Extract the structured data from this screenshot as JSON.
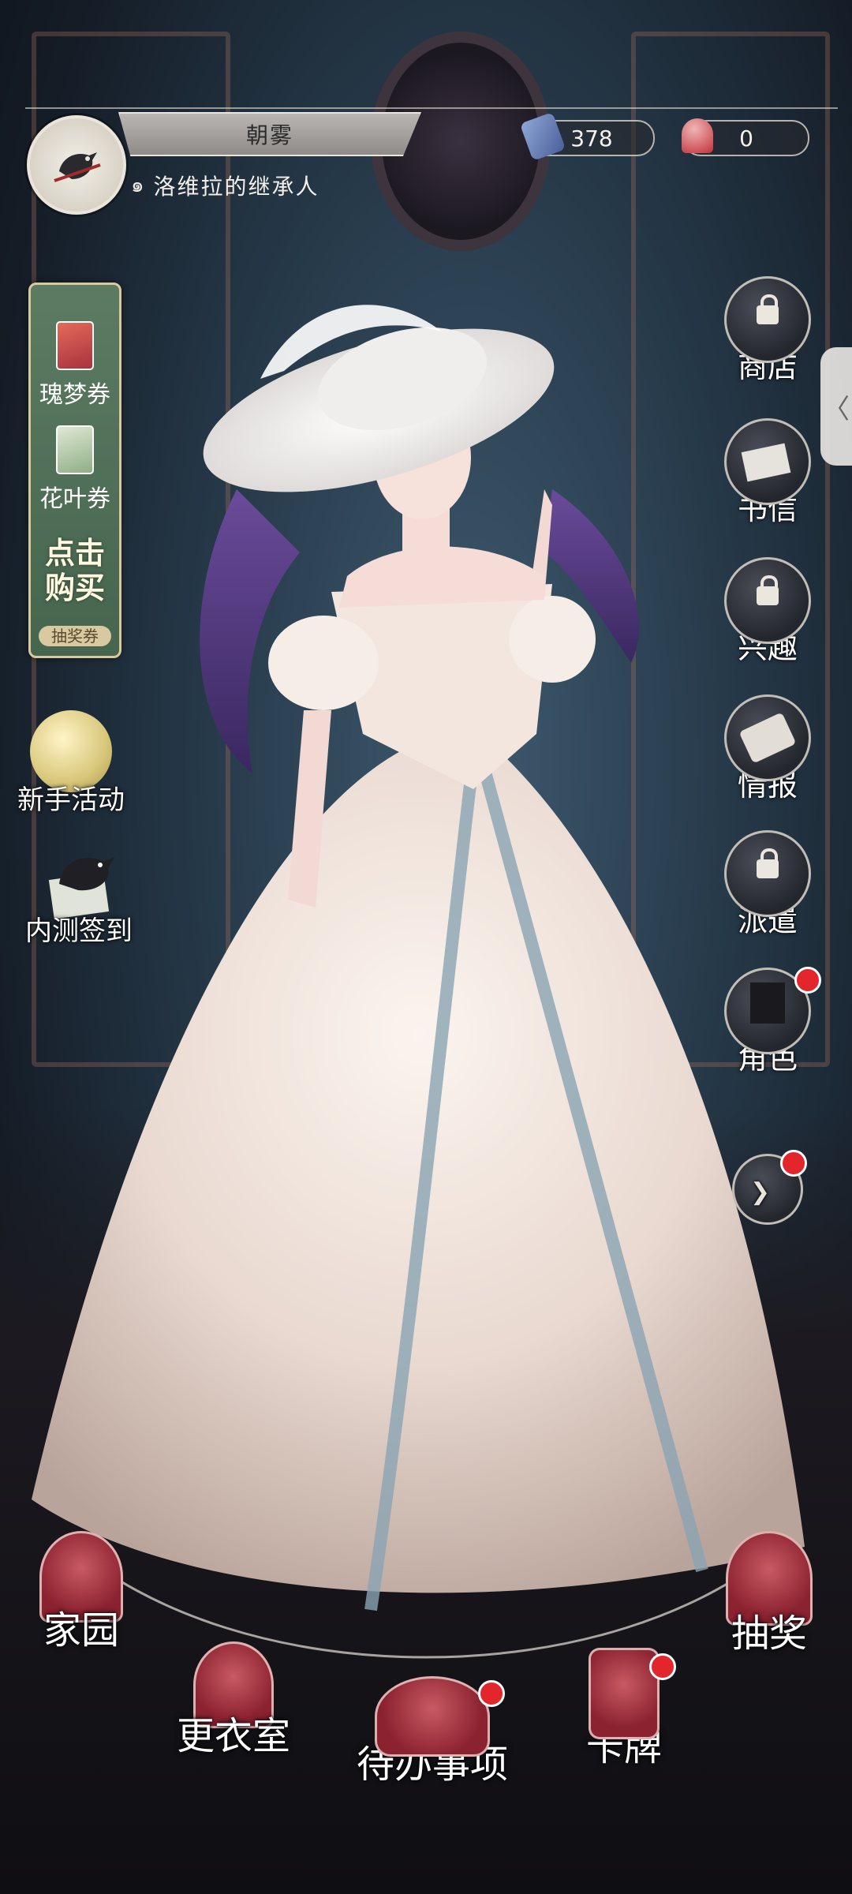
{
  "player": {
    "name": "朝雾",
    "title": "洛维拉的继承人"
  },
  "currencies": [
    {
      "icon": "quill-icon",
      "value": "378"
    },
    {
      "icon": "bell-icon",
      "value": "0"
    }
  ],
  "tickets": {
    "items": [
      {
        "label": "瑰梦券",
        "icon": "rose-card-icon"
      },
      {
        "label": "花叶券",
        "icon": "leaf-card-icon"
      }
    ],
    "buy_label_1": "点击",
    "buy_label_2": "购买",
    "buy_sub": "抽奖券"
  },
  "left_buttons": [
    {
      "label": "新手活动",
      "icon": "golden-orb-icon"
    },
    {
      "label": "内测签到",
      "icon": "crow-letter-icon"
    }
  ],
  "right_menu": [
    {
      "label": "商店",
      "locked": true
    },
    {
      "label": "书信",
      "locked": false
    },
    {
      "label": "兴趣",
      "locked": true
    },
    {
      "label": "情报",
      "locked": false
    },
    {
      "label": "派遣",
      "locked": true
    },
    {
      "label": "角色",
      "locked": false,
      "badge": true
    },
    {
      "label": "",
      "locked": false,
      "badge": true
    }
  ],
  "side_tab": "〈",
  "bottom_nav": [
    {
      "label": "家园",
      "icon": "arch-window-icon"
    },
    {
      "label": "更衣室",
      "icon": "dress-icon"
    },
    {
      "label": "待办事项",
      "icon": "hat-icon",
      "badge": true
    },
    {
      "label": "卡牌",
      "icon": "card-icon",
      "badge": true
    },
    {
      "label": "抽奖",
      "icon": "rose-icon"
    }
  ],
  "colors": {
    "accent_red": "#e3262c",
    "panel_green": "#4f6e57",
    "emblem_red": "#a8323e"
  }
}
